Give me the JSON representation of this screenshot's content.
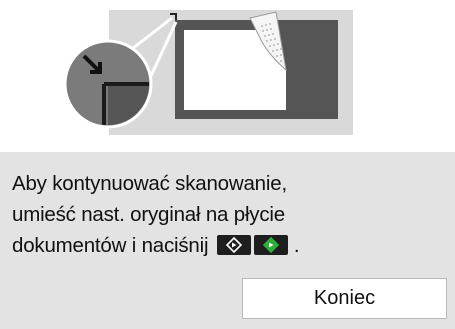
{
  "illustration": {
    "icon": "platen-document-placement-illustration"
  },
  "message": {
    "line1": "Aby kontynuować skanowanie,",
    "line2": "umieść nast. oryginał na płycie",
    "line3": "dokumentów i naciśnij",
    "period": ".",
    "icons": [
      "black-start-button-icon",
      "color-start-button-icon"
    ]
  },
  "buttons": {
    "end_label": "Koniec"
  },
  "colors": {
    "panel_background": "#e3e3e3",
    "illustration_background": "#dcdcdc",
    "glass_dark": "#555555",
    "start_color_accent": "#2fae3c",
    "start_black": "#1e1e1e"
  }
}
